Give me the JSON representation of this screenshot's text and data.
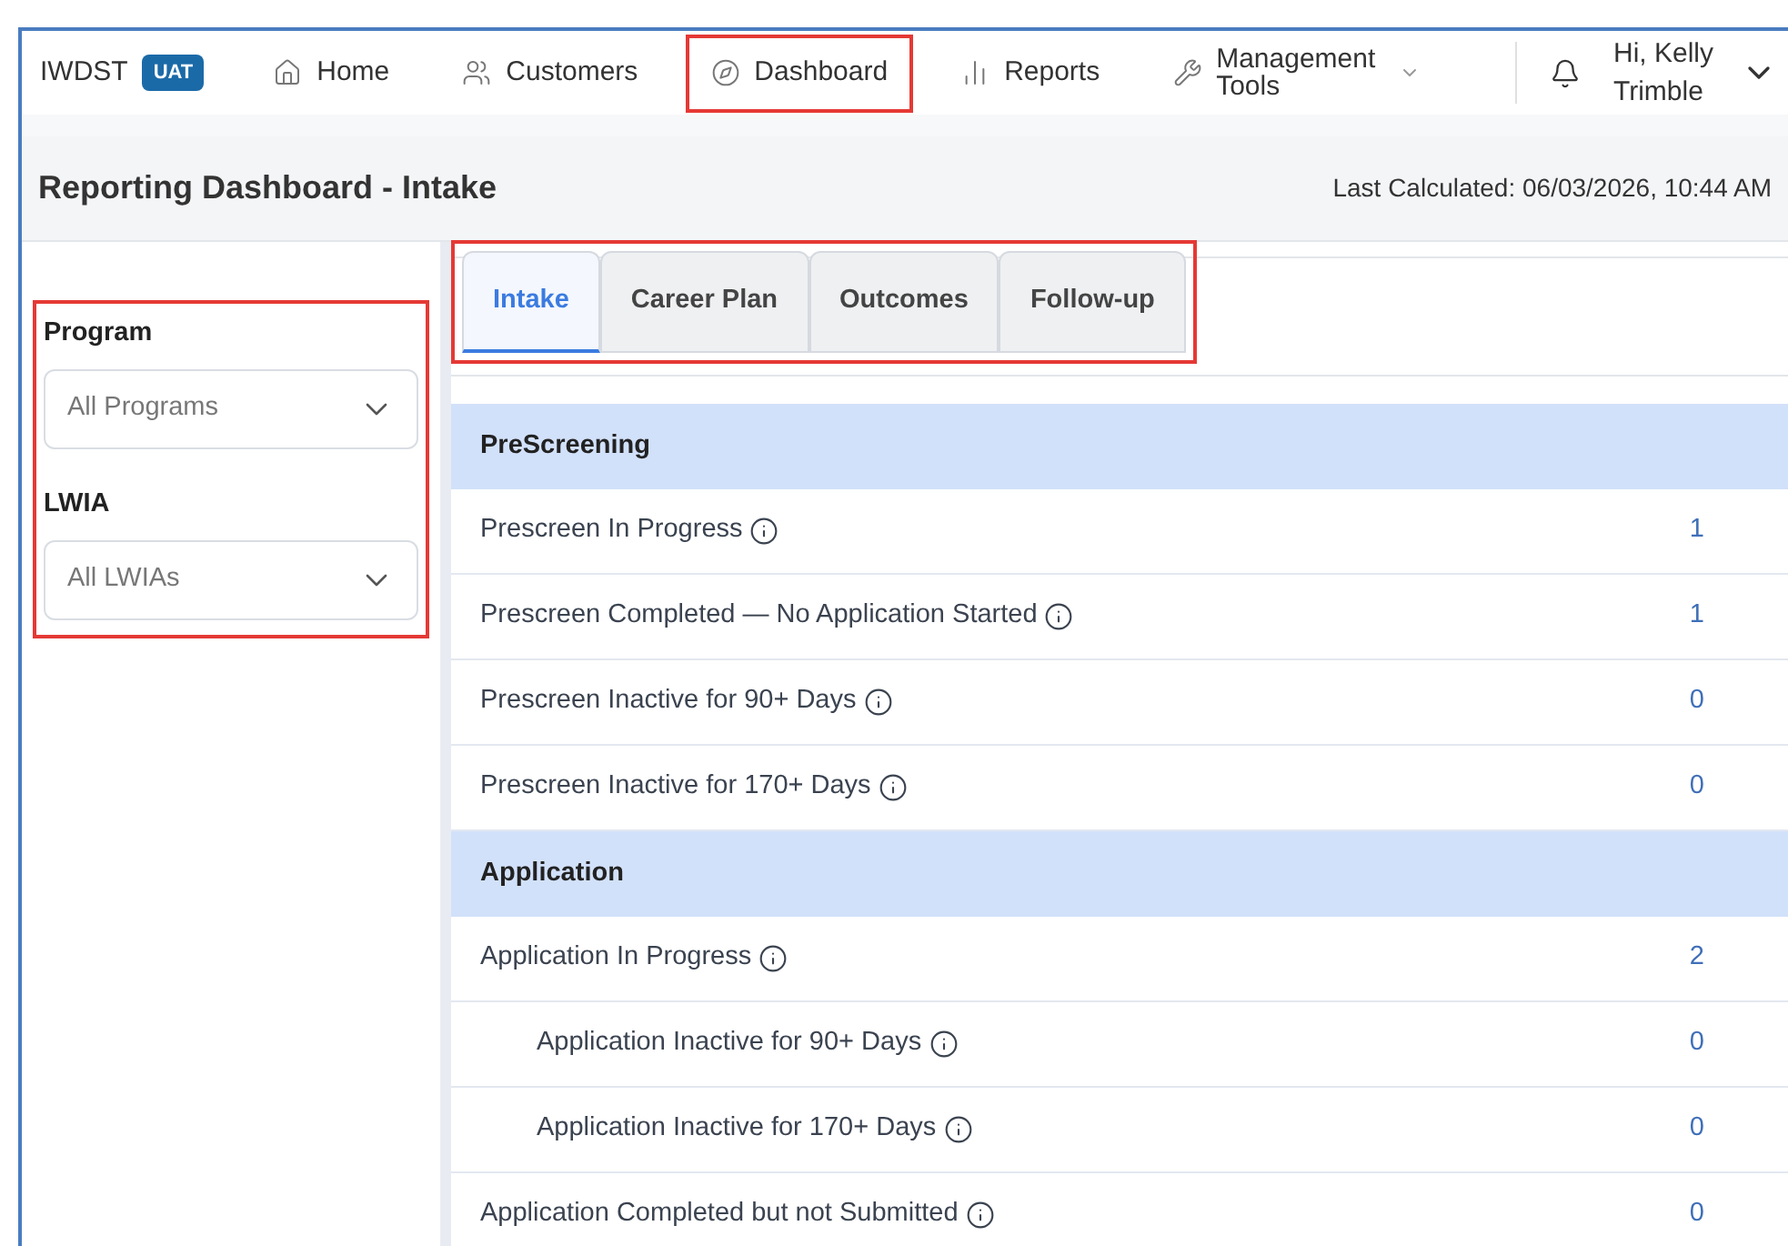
{
  "app": {
    "name": "IWDST",
    "env_badge": "UAT"
  },
  "nav": [
    {
      "label": "Home",
      "highlighted": false,
      "dropdown": false
    },
    {
      "label": "Customers",
      "highlighted": false,
      "dropdown": false
    },
    {
      "label": "Dashboard",
      "highlighted": true,
      "dropdown": false
    },
    {
      "label": "Reports",
      "highlighted": false,
      "dropdown": false
    },
    {
      "label": "Management Tools",
      "highlighted": false,
      "dropdown": true
    }
  ],
  "user": {
    "greeting": "Hi, Kelly Trimble"
  },
  "page": {
    "title": "Reporting Dashboard - Intake",
    "last_calculated": "Last Calculated: 06/03/2026, 10:44 AM"
  },
  "filters": {
    "highlighted": true,
    "items": [
      {
        "label": "Program",
        "value": "All Programs"
      },
      {
        "label": "LWIA",
        "value": "All LWIAs"
      }
    ]
  },
  "tabs": {
    "highlighted": true,
    "items": [
      {
        "label": "Intake",
        "selected": true
      },
      {
        "label": "Career Plan",
        "selected": false
      },
      {
        "label": "Outcomes",
        "selected": false
      },
      {
        "label": "Follow-up",
        "selected": false
      }
    ]
  },
  "sections": [
    {
      "title": "PreScreening",
      "rows": [
        {
          "label": "Prescreen In Progress",
          "value": "1"
        },
        {
          "label": "Prescreen Completed — No Application Started",
          "value": "1"
        },
        {
          "label": "Prescreen Inactive for 90+ Days",
          "value": "0"
        },
        {
          "label": "Prescreen Inactive for 170+ Days",
          "value": "0"
        }
      ]
    },
    {
      "title": "Application",
      "rows": [
        {
          "label": "Application In Progress",
          "value": "2",
          "children": [
            {
              "label": "Application Inactive for 90+ Days",
              "value": "0"
            },
            {
              "label": "Application Inactive for 170+ Days",
              "value": "0"
            }
          ]
        },
        {
          "label": "Application Completed but not Submitted",
          "value": "0"
        }
      ]
    }
  ]
}
